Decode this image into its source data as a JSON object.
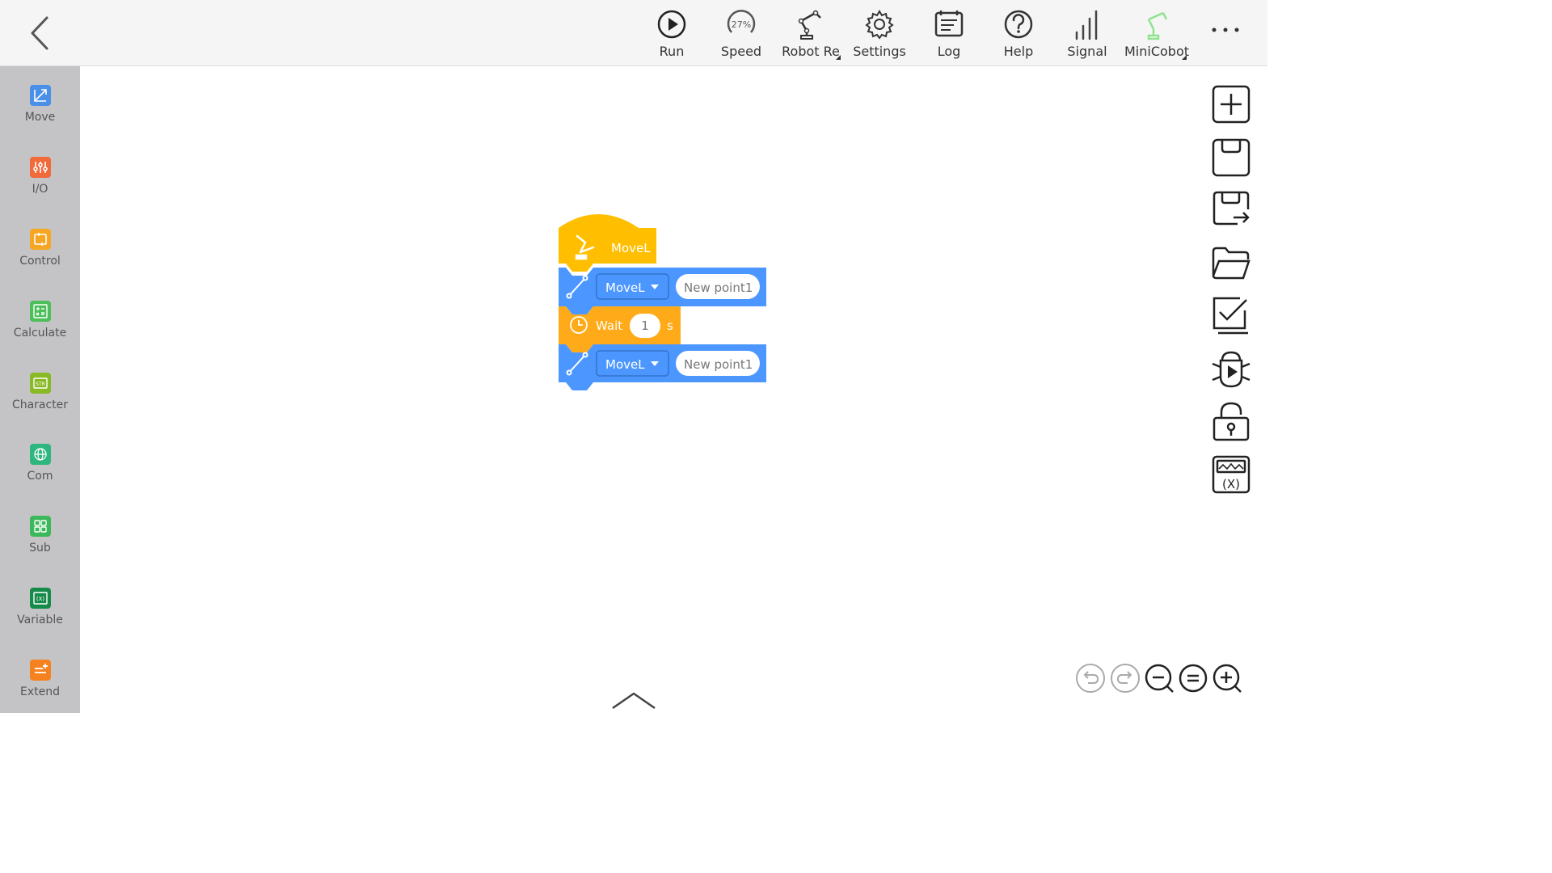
{
  "toolbar": {
    "items": [
      {
        "label": "Run",
        "icon": "play-circle-icon"
      },
      {
        "label": "Speed",
        "icon": "speed-gauge-icon",
        "value": "27%"
      },
      {
        "label": "Robot Re",
        "icon": "robot-arm-icon"
      },
      {
        "label": "Settings",
        "icon": "gear-icon"
      },
      {
        "label": "Log",
        "icon": "log-icon"
      },
      {
        "label": "Help",
        "icon": "help-icon"
      },
      {
        "label": "Signal",
        "icon": "signal-bars-icon"
      },
      {
        "label": "MiniCobot",
        "icon": "robot-arm-green-icon"
      }
    ]
  },
  "sidebar": {
    "categories": [
      {
        "label": "Move",
        "color": "#4a8fe8"
      },
      {
        "label": "I/O",
        "color": "#f06a3a"
      },
      {
        "label": "Control",
        "color": "#f7a623"
      },
      {
        "label": "Calculate",
        "color": "#4cbf5a"
      },
      {
        "label": "Character",
        "color": "#8ab926"
      },
      {
        "label": "Com",
        "color": "#2fb57e"
      },
      {
        "label": "Sub",
        "color": "#3bb85a"
      },
      {
        "label": "Variable",
        "color": "#168a4a"
      },
      {
        "label": "Extend",
        "color": "#f5821f"
      }
    ]
  },
  "program": {
    "hat_label": "MoveL",
    "blocks": [
      {
        "type": "move",
        "command": "MoveL",
        "point": "New point1"
      },
      {
        "type": "wait",
        "label": "Wait",
        "value": "1",
        "unit": "s"
      },
      {
        "type": "move",
        "command": "MoveL",
        "point": "New point1"
      }
    ]
  },
  "colors": {
    "hat": "#ffbf00",
    "move_block": "#4c97ff",
    "wait_block": "#ffab19",
    "sidebar_bg": "#c4c4c7",
    "topbar_bg": "#f5f5f5"
  },
  "right_tools": [
    "new-file-icon",
    "save-icon",
    "save-as-icon",
    "open-folder-icon",
    "check-icon",
    "debug-icon",
    "lock-icon",
    "variable-monitor-icon"
  ],
  "canvas_controls": [
    "undo-icon",
    "redo-icon",
    "zoom-out-icon",
    "zoom-reset-icon",
    "zoom-in-icon"
  ]
}
